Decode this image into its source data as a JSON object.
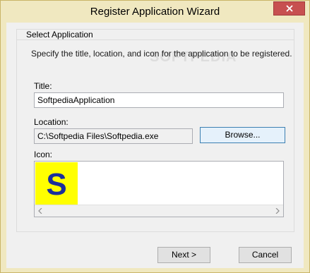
{
  "window": {
    "title": "Register Application Wizard",
    "accent_color": "#f0e8c0",
    "close_color": "#c75050"
  },
  "group": {
    "title": "Select Application",
    "description": "Specify the title, location, and icon for the application to be registered.",
    "watermark": "SOFTPEDIA"
  },
  "fields": {
    "title_label": "Title:",
    "title_value": "SoftpediaApplication",
    "location_label": "Location:",
    "location_value": "C:\\Softpedia Files\\Softpedia.exe",
    "browse_label": "Browse...",
    "icon_label": "Icon:"
  },
  "icon_preview": {
    "icon": "softpedia-s-icon",
    "glyph": "S",
    "background": "#ffff00",
    "foreground": "#1a2e9c"
  },
  "buttons": {
    "next_label": "Next >",
    "cancel_label": "Cancel"
  }
}
